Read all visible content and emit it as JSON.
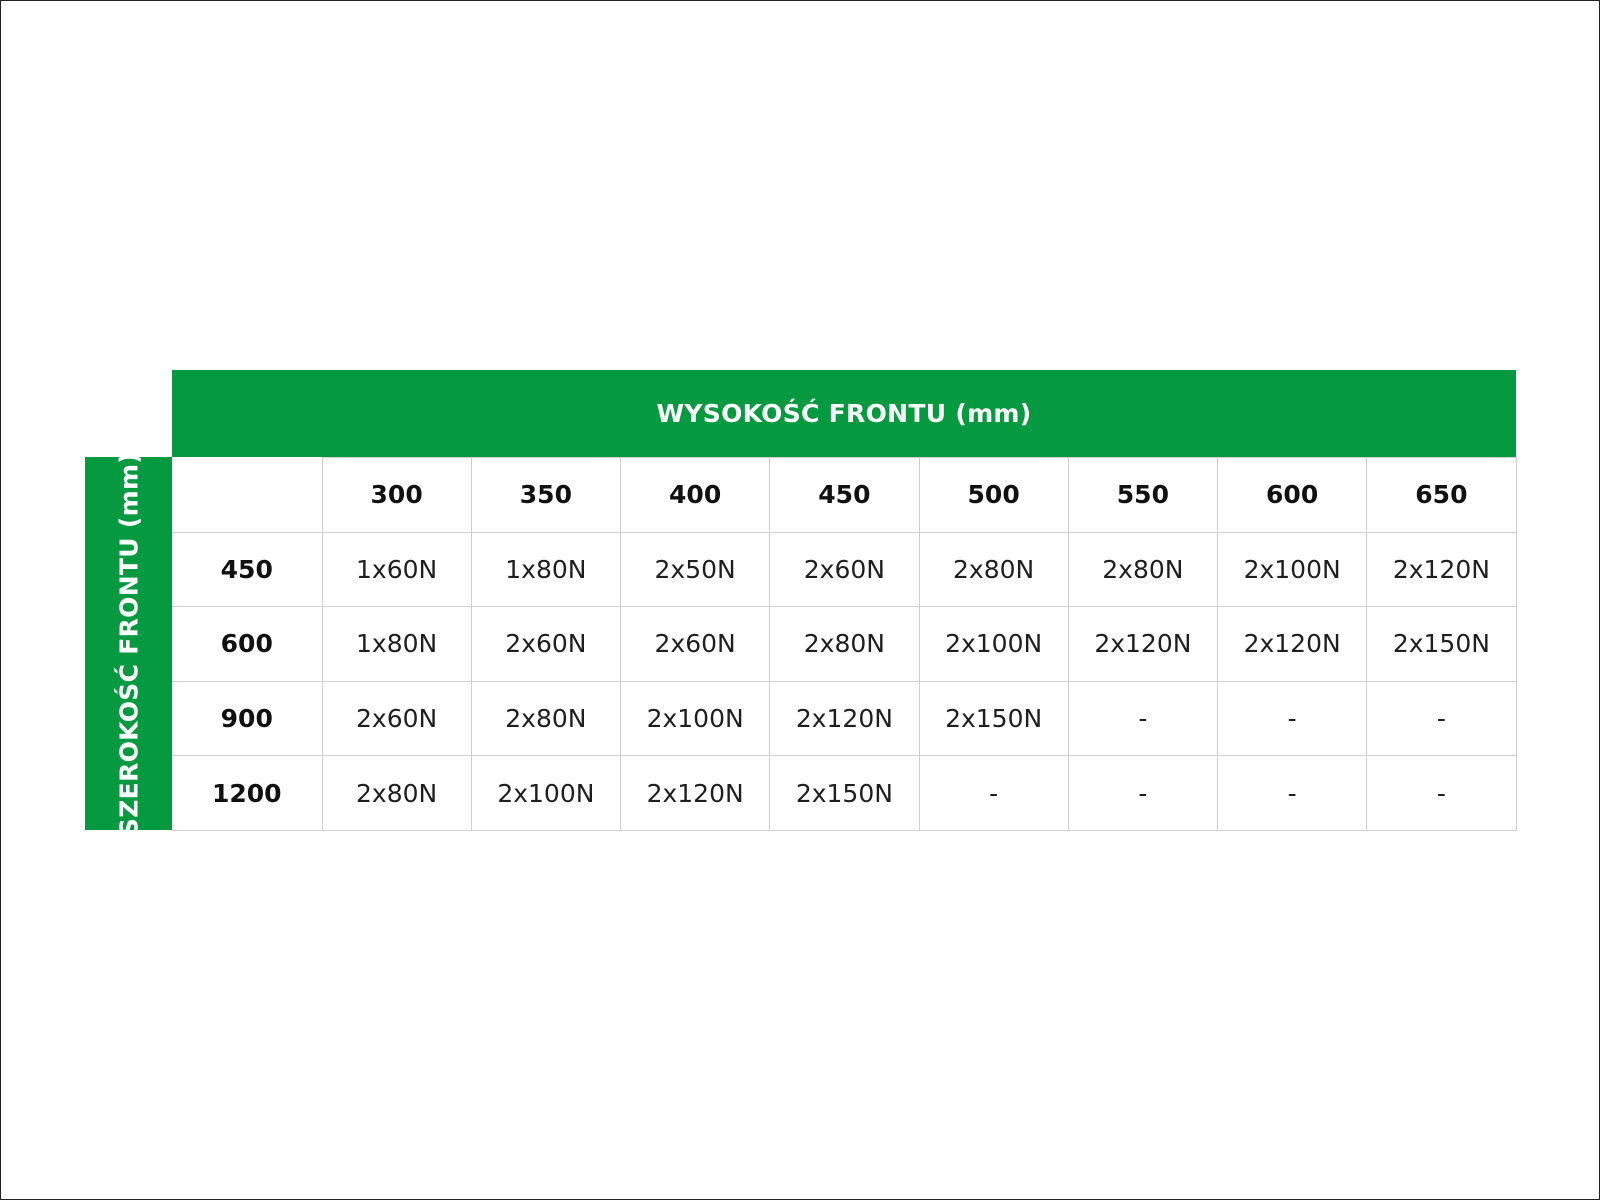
{
  "colors": {
    "accent": "#059a3f",
    "header_text": "#ffffff",
    "grid_line": "#cfcfcf"
  },
  "header": {
    "title": "WYSOKOŚĆ FRONTU (mm)"
  },
  "side": {
    "title": "SZEROKOŚĆ FRONTU (mm)"
  },
  "table": {
    "columns": [
      "300",
      "350",
      "400",
      "450",
      "500",
      "550",
      "600",
      "650"
    ],
    "rows": [
      {
        "label": "450",
        "cells": [
          "1x60N",
          "1x80N",
          "2x50N",
          "2x60N",
          "2x80N",
          "2x80N",
          "2x100N",
          "2x120N"
        ]
      },
      {
        "label": "600",
        "cells": [
          "1x80N",
          "2x60N",
          "2x60N",
          "2x80N",
          "2x100N",
          "2x120N",
          "2x120N",
          "2x150N"
        ]
      },
      {
        "label": "900",
        "cells": [
          "2x60N",
          "2x80N",
          "2x100N",
          "2x120N",
          "2x150N",
          "-",
          "-",
          "-"
        ]
      },
      {
        "label": "1200",
        "cells": [
          "2x80N",
          "2x100N",
          "2x120N",
          "2x150N",
          "-",
          "-",
          "-",
          "-"
        ]
      }
    ]
  }
}
